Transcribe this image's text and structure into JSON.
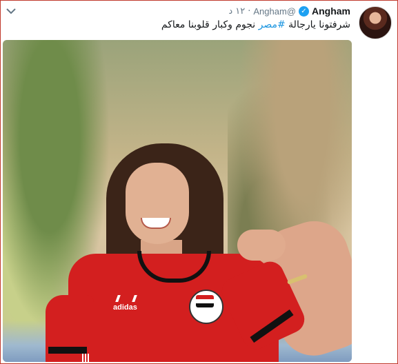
{
  "tweet": {
    "display_name": "Angham",
    "handle": "@Angham",
    "time_number": "١٢",
    "time_unit": "د",
    "separator": "·",
    "verified_icon": "verified-badge-icon",
    "text_prefix": "شرفتونا يارجالة ",
    "hashtag": "#مصر",
    "text_suffix": " نجوم وكبار قلوبنا معاكم",
    "menu_icon": "chevron-down-icon"
  },
  "media": {
    "jersey_logo_text": "adidas"
  },
  "colors": {
    "accent": "#1b95e0",
    "verified": "#1da1f2",
    "frame_border": "#c0392b",
    "jersey_red": "#d31f1f"
  }
}
